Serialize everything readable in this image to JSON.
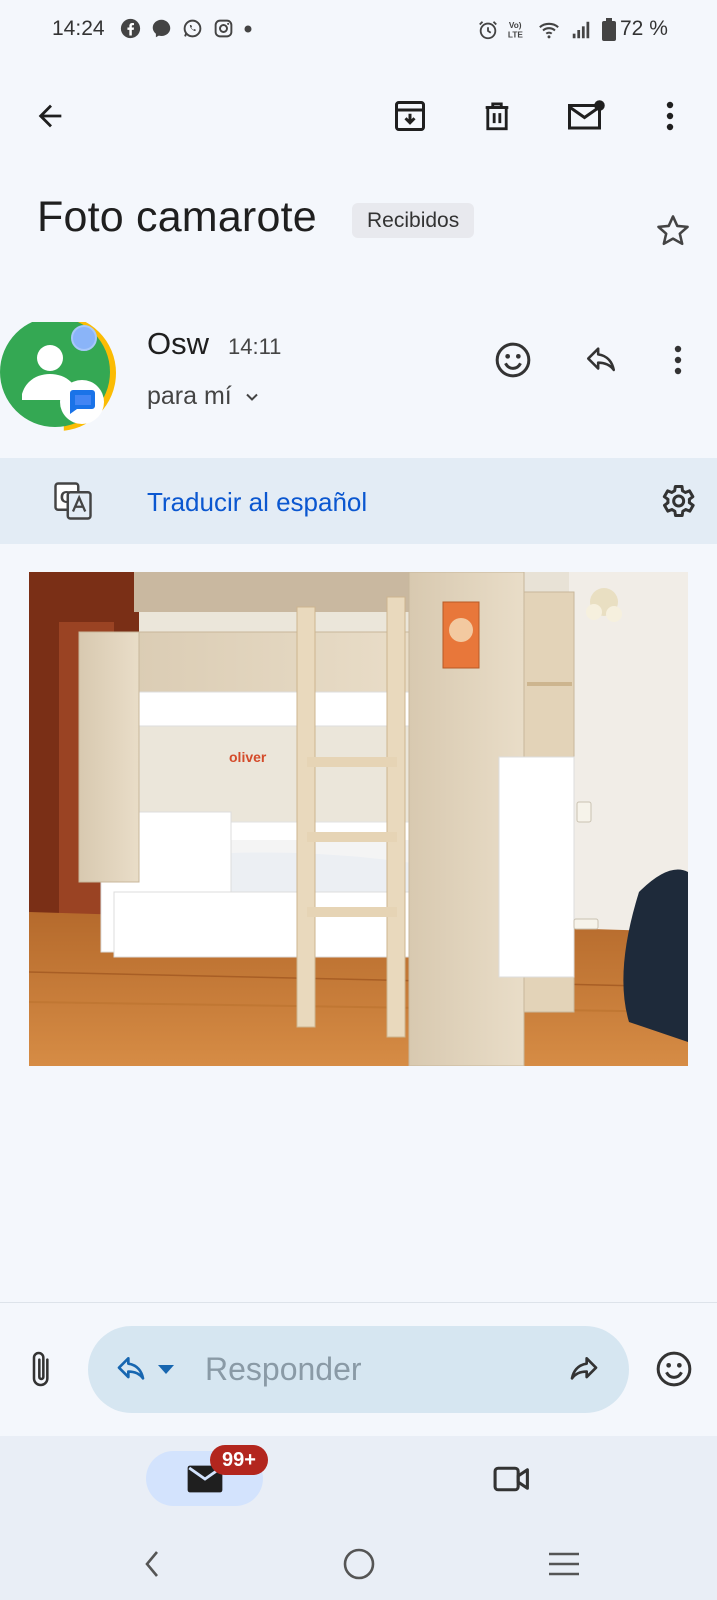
{
  "status_bar": {
    "time": "14:24",
    "battery_text": "72 %",
    "left_icons": [
      "facebook-icon",
      "messenger-icon",
      "whatsapp-icon",
      "instagram-icon",
      "dot-icon"
    ],
    "right_icons": [
      "alarm-icon",
      "volte-icon",
      "wifi-icon",
      "signal-icon",
      "battery-icon"
    ]
  },
  "toolbar": {
    "back_icon": "arrow-left-icon",
    "archive_icon": "archive-icon",
    "delete_icon": "trash-icon",
    "mark_unread_icon": "mail-unread-icon",
    "more_icon": "more-vert-icon"
  },
  "email": {
    "subject": "Foto camarote",
    "label": "Recibidos",
    "sender_name": "Osw",
    "time": "14:11",
    "to_text": "para mí"
  },
  "translate": {
    "link_text": "Traducir al español"
  },
  "reply": {
    "placeholder": "Responder"
  },
  "bottom_nav": {
    "mail_badge": "99+",
    "items": [
      "mail-icon",
      "video-icon"
    ]
  },
  "colors": {
    "accent_blue": "#0b57d0",
    "badge_red": "#b3261e",
    "background": "#f4f7fc",
    "translate_bar": "#e3ecf5",
    "reply_pill": "#d6e6f1",
    "avatar_green": "#34a853",
    "avatar_yellow": "#fbbc04"
  }
}
